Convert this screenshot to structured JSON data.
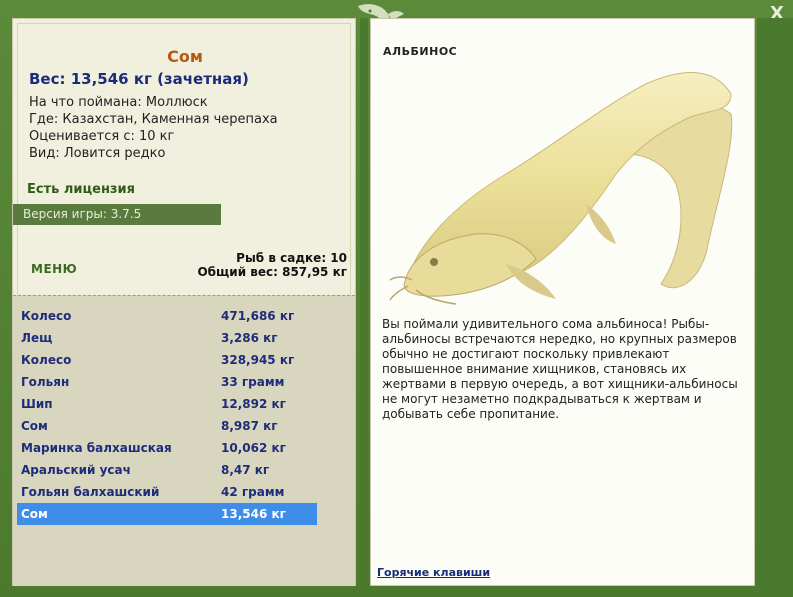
{
  "window": {
    "close_label": "X"
  },
  "fish": {
    "title": "Сом",
    "weight": "Вес: 13,546 кг (зачетная)",
    "caught_with": "На что поймана: Моллюск",
    "where": "Где: Казахстан, Каменная черепаха",
    "rated_from": "Оценивается с: 10 кг",
    "kind": "Вид: Ловится редко"
  },
  "license": "Есть лицензия",
  "version": "Версия игры: 3.7.5",
  "menu_label": "МЕНЮ",
  "keep": {
    "count": "Рыб в садке: 10",
    "total": "Общий вес: 857,95 кг"
  },
  "catch_list": [
    {
      "name": "Колесо",
      "weight": "471,686 кг"
    },
    {
      "name": "Лещ",
      "weight": "3,286 кг"
    },
    {
      "name": "Колесо",
      "weight": "328,945 кг"
    },
    {
      "name": "Гольян",
      "weight": "33 грамм"
    },
    {
      "name": "Шип",
      "weight": "12,892 кг"
    },
    {
      "name": "Сом",
      "weight": "8,987 кг"
    },
    {
      "name": "Маринка балхашская",
      "weight": "10,062 кг"
    },
    {
      "name": "Аральский усач",
      "weight": "8,47 кг"
    },
    {
      "name": "Гольян балхашский",
      "weight": "42 грамм"
    },
    {
      "name": "Сом",
      "weight": "13,546 кг"
    }
  ],
  "selected_index": 9,
  "right": {
    "label": "АЛЬБИНОС",
    "description": "Вы поймали удивительного сома альбиноса! Рыбы-альбиносы встречаются нередко, но крупных размеров обычно не достигают поскольку привлекают повышенное внимание хищников, становясь их жертвами в первую очередь, а вот хищники-альбиносы не могут незаметно подкрадываться к жертвам и добывать себе пропитание.",
    "hotkeys": "Горячие клавиши"
  },
  "colors": {
    "frame": "#4b7a2e",
    "title": "#b65a12",
    "list_text": "#1f2c7a",
    "selection": "#3d8de9"
  }
}
